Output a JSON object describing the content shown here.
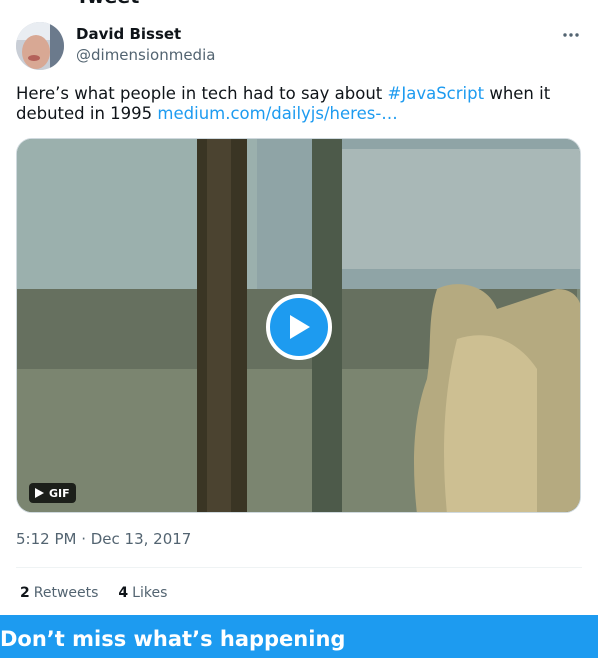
{
  "page_header": {
    "title": "Tweet"
  },
  "author": {
    "name": "David Bisset",
    "handle": "@dimensionmedia"
  },
  "tweet": {
    "text_before": "Here’s what people in tech had to say about ",
    "hashtag": "#JavaScript",
    "text_after": " when it debuted in 1995 ",
    "link": "medium.com/dailyjs/heres-…"
  },
  "media": {
    "badge_label": "GIF",
    "play_icon": "play-icon"
  },
  "meta": {
    "timestamp": "5:12 PM · Dec 13, 2017"
  },
  "stats": {
    "retweets_count": "2",
    "retweets_label": "Retweets",
    "likes_count": "4",
    "likes_label": "Likes"
  },
  "banner": {
    "title": "Don’t miss what’s happening"
  },
  "colors": {
    "accent": "#1d9bf0",
    "text": "#0f1419",
    "muted": "#536471"
  }
}
